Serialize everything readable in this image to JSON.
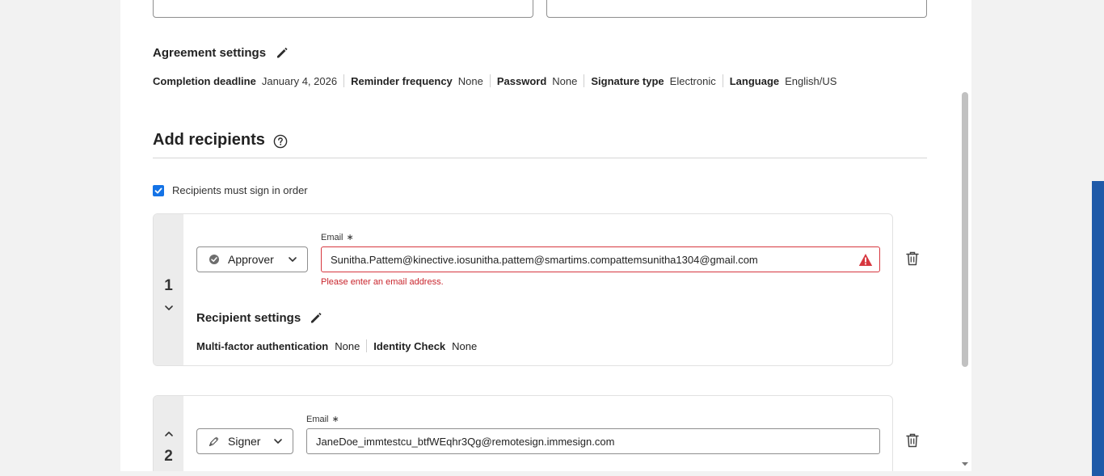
{
  "agreement": {
    "title": "Agreement settings",
    "settings": [
      {
        "label": "Completion deadline",
        "value": "January 4, 2026"
      },
      {
        "label": "Reminder frequency",
        "value": "None"
      },
      {
        "label": "Password",
        "value": "None"
      },
      {
        "label": "Signature type",
        "value": "Electronic"
      },
      {
        "label": "Language",
        "value": "English/US"
      }
    ]
  },
  "recipients": {
    "title": "Add recipients",
    "sign_in_order_label": "Recipients must sign in order",
    "sign_in_order_checked": true,
    "email_label": "Email",
    "required_mark": "∗",
    "list": [
      {
        "number": "1",
        "role": "Approver",
        "role_icon": "check-circle-icon",
        "email": "Sunitha.Pattem@kinective.iosunitha.pattem@smartims.compattemsunitha1304@gmail.com",
        "error": "Please enter an email address.",
        "settings_title": "Recipient settings",
        "settings": [
          {
            "label": "Multi-factor authentication",
            "value": "None"
          },
          {
            "label": "Identity Check",
            "value": "None"
          }
        ]
      },
      {
        "number": "2",
        "role": "Signer",
        "role_icon": "pen-icon",
        "email": "JaneDoe_immtestcu_btfWEqhr3Qg@remotesign.immesign.com"
      }
    ]
  },
  "colors": {
    "accent": "#1473e6",
    "error": "#d7373f",
    "side_bar": "#1f5aa8"
  }
}
